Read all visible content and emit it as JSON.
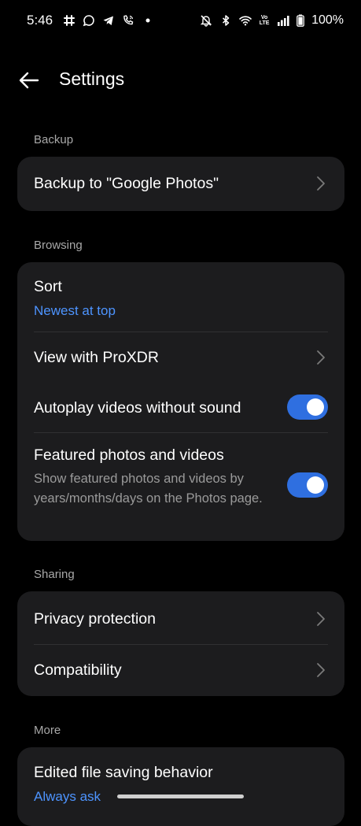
{
  "status_bar": {
    "time": "5:46",
    "battery_percent": "100%",
    "network_label_top": "Vo",
    "network_label_bottom": "LTE",
    "left_icons": [
      "slack-icon",
      "chat-bubble-icon",
      "telegram-icon",
      "wifi-calling-icon",
      "dot-icon"
    ],
    "right_icons": [
      "mute-icon",
      "bluetooth-icon",
      "wifi-icon",
      "volte-icon",
      "signal-icon",
      "battery-icon"
    ]
  },
  "header": {
    "title": "Settings"
  },
  "sections": {
    "backup": {
      "label": "Backup",
      "items": {
        "google_photos": {
          "title": "Backup to \"Google Photos\""
        }
      }
    },
    "browsing": {
      "label": "Browsing",
      "items": {
        "sort": {
          "title": "Sort",
          "value": "Newest at top"
        },
        "proxdr": {
          "title": "View with ProXDR"
        },
        "autoplay": {
          "title": "Autoplay videos without sound",
          "enabled": true
        },
        "featured": {
          "title": "Featured photos and videos",
          "description": "Show featured photos and videos by years/months/days on the Photos page.",
          "enabled": true
        }
      }
    },
    "sharing": {
      "label": "Sharing",
      "items": {
        "privacy": {
          "title": "Privacy protection"
        },
        "compatibility": {
          "title": "Compatibility"
        }
      }
    },
    "more": {
      "label": "More",
      "items": {
        "edited_saving": {
          "title": "Edited file saving behavior",
          "value": "Always ask"
        }
      }
    }
  },
  "colors": {
    "background": "#000000",
    "card": "#1c1c1e",
    "accent_blue": "#4d94ff",
    "toggle_on": "#2f6fe0",
    "section_label": "#a8a8a8"
  }
}
